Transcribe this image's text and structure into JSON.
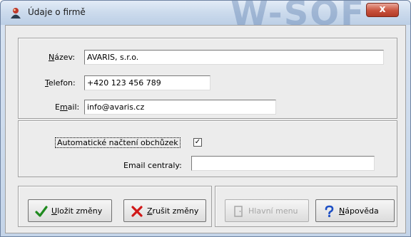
{
  "window": {
    "title": "Údaje o firmě",
    "watermark": "W-SOF",
    "close_glyph": "x"
  },
  "company": {
    "name_label_u": "N",
    "name_label": "ázev:",
    "name_value": "AVARIS, s.r.o.",
    "phone_label_u": "T",
    "phone_label": "elefon:",
    "phone_value": "+420 123 456 789",
    "email_label_pre": "E",
    "email_label_u": "m",
    "email_label": "ail:",
    "email_value": "info@avaris.cz"
  },
  "options": {
    "auto_load_label": "Automatické načtení obchůzek",
    "auto_load_checked": true,
    "central_email_label": "Email centraly:",
    "central_email_value": ""
  },
  "buttons": {
    "save_u": "U",
    "save": "ložit změny",
    "cancel_u": "Z",
    "cancel": "rušit změny",
    "main_menu": "Hlavní menu",
    "help_u": "N",
    "help": "ápověda"
  },
  "icons": {
    "window": "company-icon",
    "save": "check-icon",
    "cancel": "cross-icon",
    "main_menu": "door-icon",
    "help": "question-icon"
  }
}
